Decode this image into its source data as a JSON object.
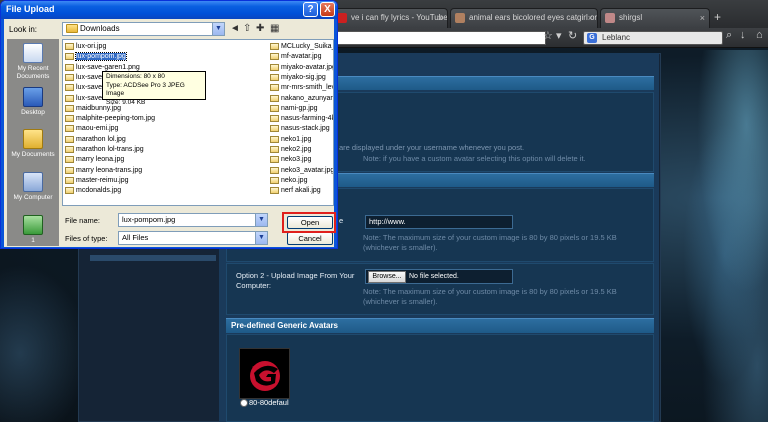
{
  "browser": {
    "tabs": [
      {
        "label": "ve i can fly lyrics - YouTube"
      },
      {
        "label": "animal ears bicolored eyes catgirl origina..."
      },
      {
        "label": "shirgsl"
      }
    ],
    "new_tab": "+",
    "search_text": "Leblanc",
    "search_engine_icon": "G"
  },
  "page": {
    "note_custom_avatar": "are displayed under your username whenever you post.",
    "note_custom_avatar2": "Note: if you have a custom avatar selecting this option will delete it.",
    "url_field_value": "http://www.",
    "url_note": "Note: The maximum size of your custom image is 80 by 80 pixels or 19.5 KB (whichever is smaller).",
    "option2_label": "Option 2 - Upload Image From Your Computer:",
    "browse_label": "Browse...",
    "no_file": "No file selected.",
    "upload_note": "Note: The maximum size of your custom image is 80 by 80 pixels or 19.5 KB (whichever is smaller).",
    "predefined_heading": "Pre-defined Generic Avatars",
    "avatar_label": "80-80defaul",
    "e_suffix": "e",
    "accent": "#2d6ea0"
  },
  "dialog": {
    "title": "File Upload",
    "help_label": "?",
    "close_label": "X",
    "look_in_label": "Look in:",
    "look_in_value": "Downloads",
    "places": [
      {
        "label": "My Recent Documents",
        "icon": "recent-documents-icon"
      },
      {
        "label": "Desktop",
        "icon": "desktop-icon"
      },
      {
        "label": "My Documents",
        "icon": "my-documents-icon"
      },
      {
        "label": "My Computer",
        "icon": "my-computer-icon"
      },
      {
        "label": "1",
        "icon": "network-icon"
      }
    ],
    "files_col1": [
      "lux-ori.jpg",
      "lux-pompom.jpg",
      "lux-save-garen1.png",
      "lux-save",
      "lux-save",
      "lux-save",
      "maidbunny.jpg",
      "malphite-peeping-tom.jpg",
      "maou-emi.jpg",
      "marathon lol.jpg",
      "marathon lol-trans.jpg",
      "marry leona.jpg",
      "marry leona-trans.jpg",
      "master-reimu.jpg",
      "mcdonalds.jpg"
    ],
    "files_col2": [
      "MCLucky_Suika_lo",
      "mf-avatar.jpg",
      "miyako-avatar.jpg",
      "miyako-sig.jpg",
      "mr-mrs-smith_levi",
      "nakano_azunyan_",
      "nami-gp.jpg",
      "nasus-farming-4k",
      "nasus-stack.jpg",
      "neko1.jpg",
      "neko2.jpg",
      "neko3.jpg",
      "neko3_avatar.jpg",
      "neko.jpg",
      "nerf akali.jpg"
    ],
    "selected_file": "lux-pompom.jpg",
    "tooltip": [
      "Dimensions: 80 x 80",
      "Type: ACDSee Pro 3 JPEG Image",
      "Size: 9.04 KB"
    ],
    "file_name_label": "File name:",
    "file_name_value": "lux-pompom.jpg",
    "file_type_label": "Files of type:",
    "file_type_value": "All Files",
    "open_label": "Open",
    "cancel_label": "Cancel"
  }
}
